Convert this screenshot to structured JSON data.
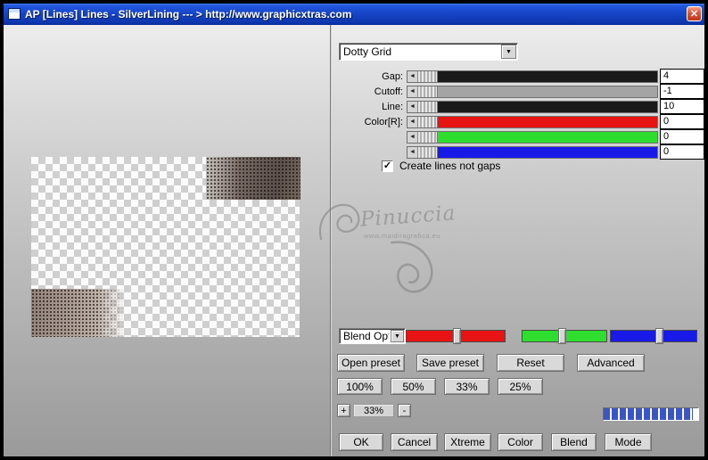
{
  "window": {
    "title": "AP [Lines]  Lines - SilverLining    --- > http://www.graphicxtras.com"
  },
  "icons": {
    "close": "✕",
    "dropdown_arrow": "▼",
    "slider_arrow": "◄",
    "check": "✓"
  },
  "colors": {
    "title_bar": "#1746C8",
    "progress_blue": "#3A55C8"
  },
  "preset_dropdown": {
    "value": "Dotty Grid"
  },
  "sliders": [
    {
      "label": "Gap:",
      "value": "4",
      "color": "#1A1A1A"
    },
    {
      "label": "Cutoff:",
      "value": "-1",
      "color": "#A4A4A4"
    },
    {
      "label": "Line:",
      "value": "10",
      "color": "#1A1A1A"
    },
    {
      "label": "Color[R]:",
      "value": "0",
      "color": "#E81414"
    },
    {
      "label": "",
      "value": "0",
      "color": "#2EDD2E"
    },
    {
      "label": "",
      "value": "0",
      "color": "#1A1AE8"
    }
  ],
  "checkbox": {
    "label": "Create lines not gaps",
    "checked": true
  },
  "watermark": {
    "name": "Pinuccia",
    "url": "www.maidiragrafica.eu"
  },
  "blend": {
    "dropdown_value": "Blend Opti",
    "sliders": [
      {
        "color": "#E81414"
      },
      {
        "color": "#2EDD2E"
      },
      {
        "color": "#1A1AE8"
      }
    ]
  },
  "preset_buttons": [
    "Open preset",
    "Save preset",
    "Reset",
    "Advanced"
  ],
  "zoom_buttons": [
    "100%",
    "50%",
    "33%",
    "25%"
  ],
  "zoom_control": {
    "plus": "+",
    "value": "33%",
    "minus": "-"
  },
  "progress": {
    "percent": 94
  },
  "bottom_buttons": [
    "OK",
    "Cancel",
    "Xtreme",
    "Color",
    "Blend",
    "Mode"
  ]
}
